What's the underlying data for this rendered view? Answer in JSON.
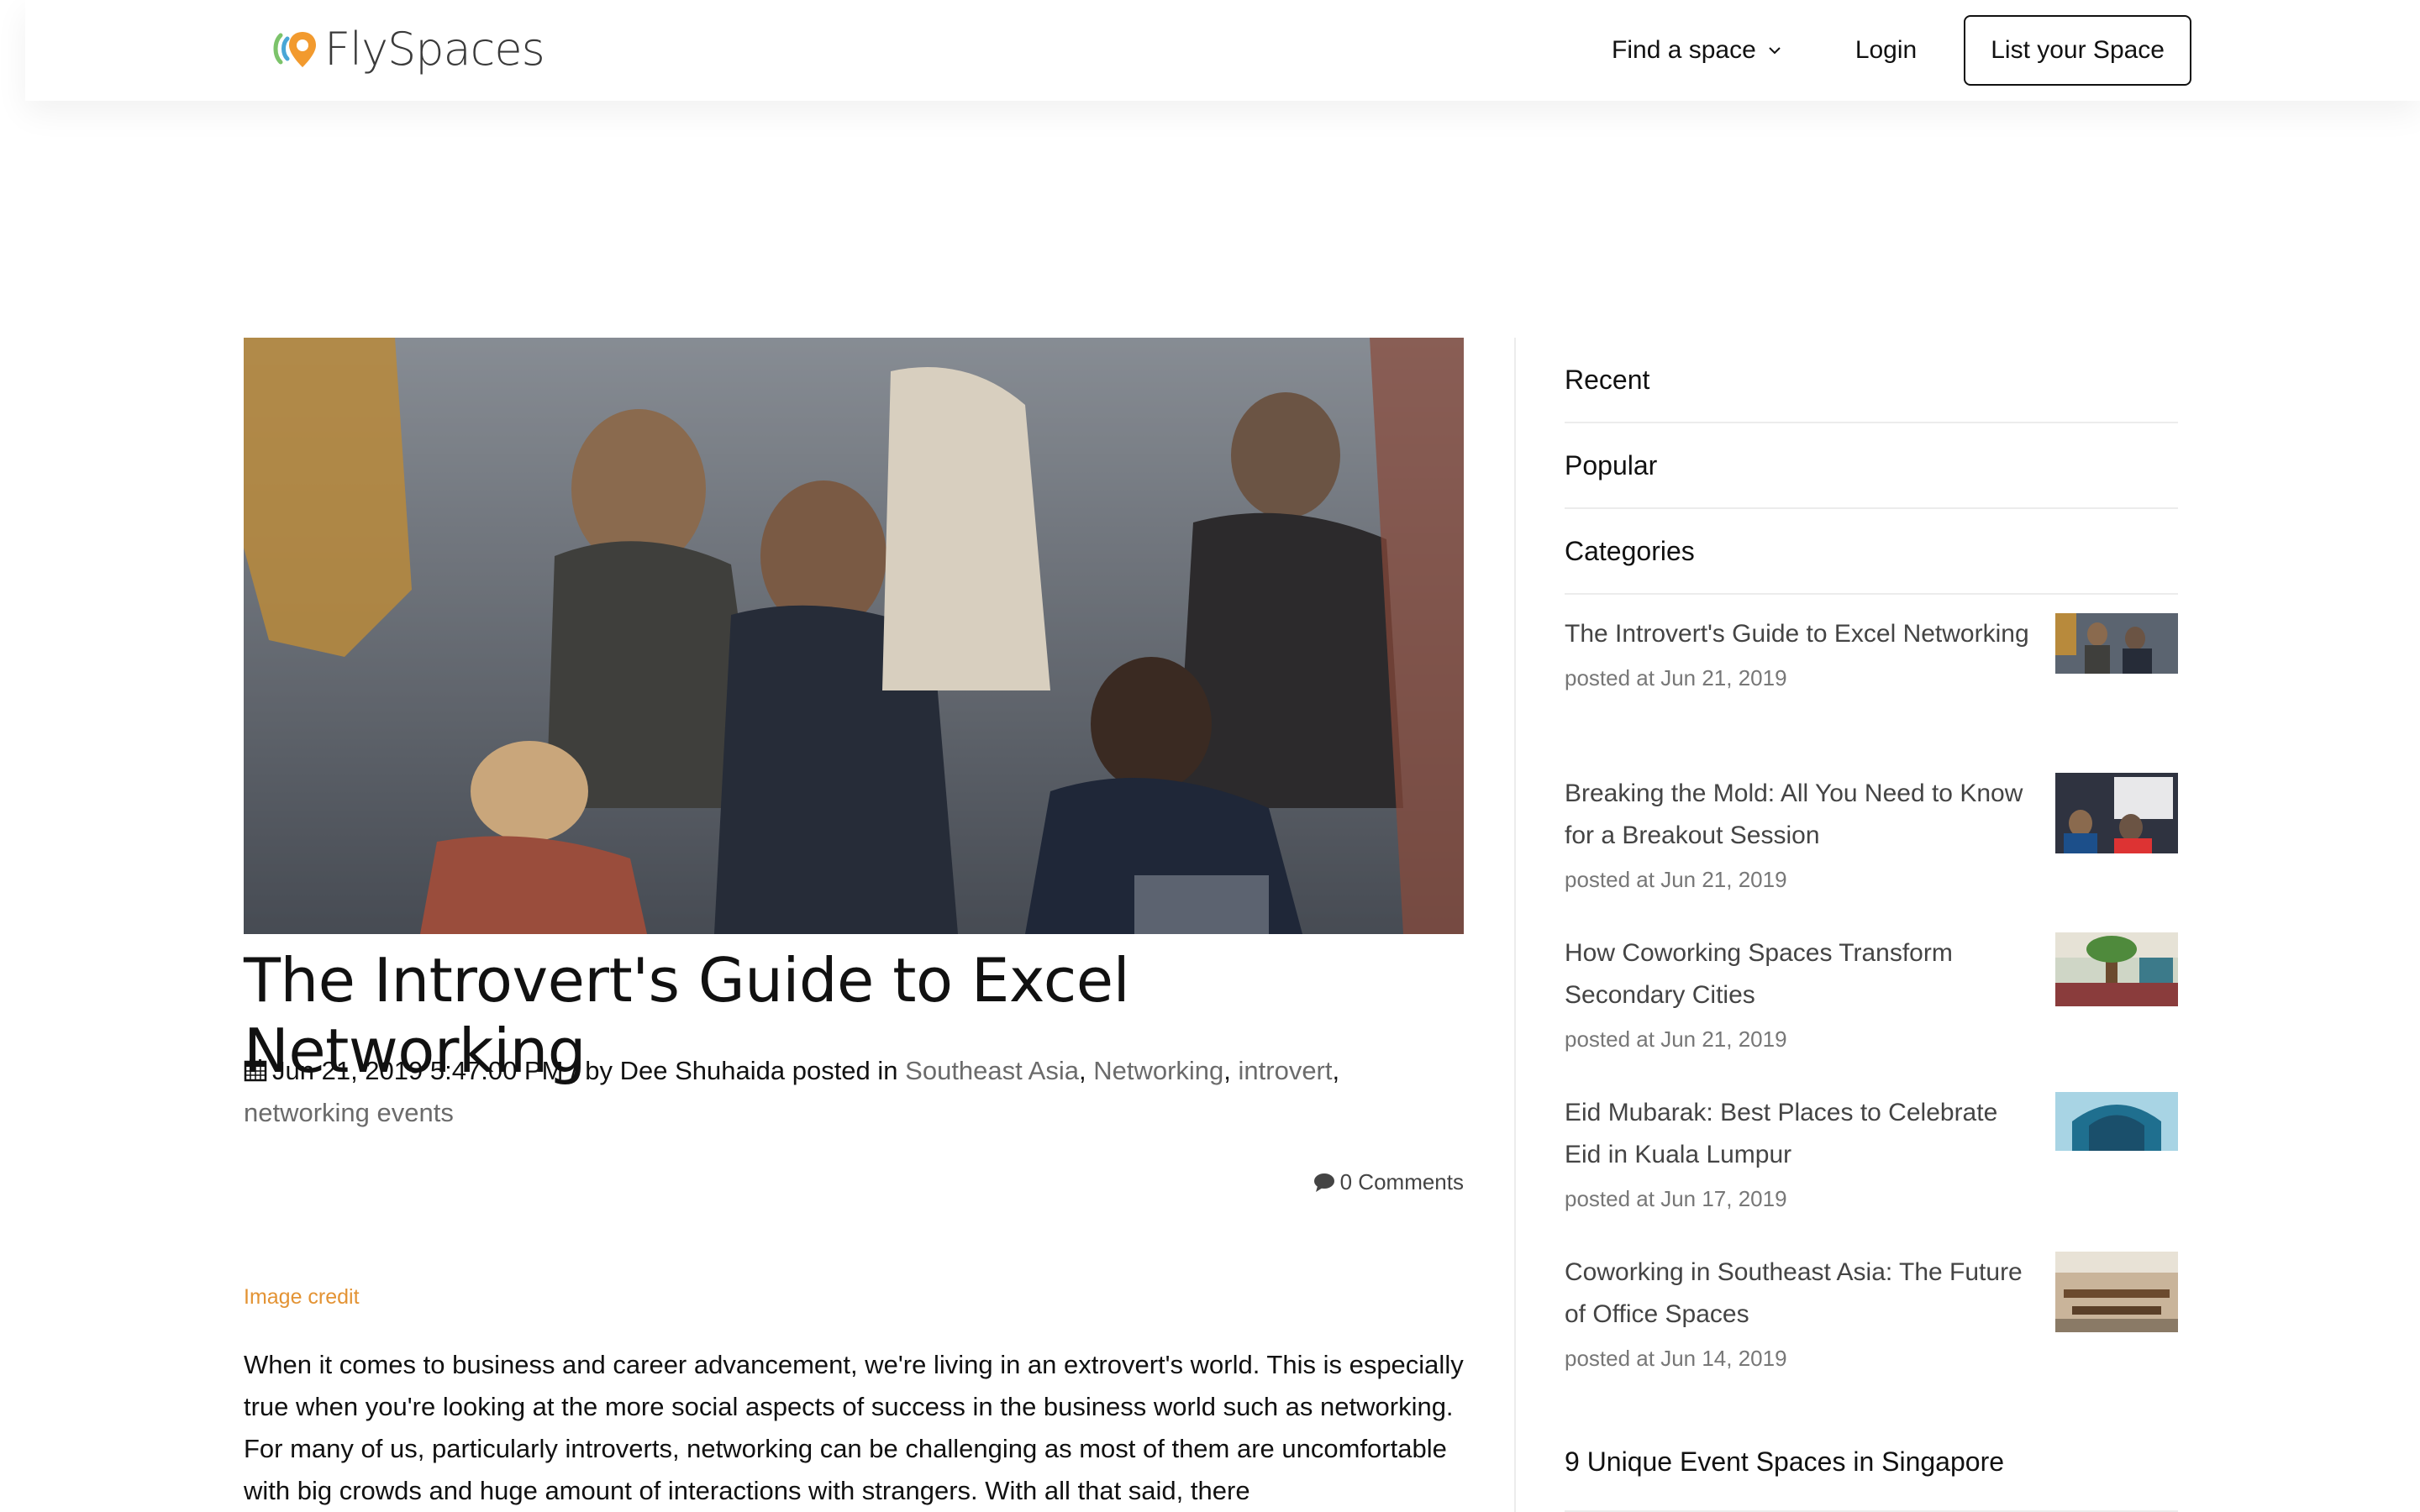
{
  "header": {
    "logo_text": "FlySpaces",
    "nav": {
      "find_label": "Find a space",
      "login_label": "Login",
      "list_label": "List your Space"
    }
  },
  "article": {
    "title": "The Introvert's Guide to Excel Networking",
    "meta": {
      "date": "Jun 21, 2019 5:47:00 PM / by Dee Shuhaida posted in",
      "tags": [
        "Southeast Asia",
        "Networking",
        "introvert",
        "networking events"
      ]
    },
    "comments_label": "0 Comments",
    "image_credit": "Image credit",
    "body": "When it comes to business and career advancement, we're living in an extrovert's world. This is especially true when you're looking at the more social aspects of success in the business world such as networking. For many of us, particularly introverts, networking can be challenging as most of them are uncomfortable with big crowds and huge amount of interactions with strangers. With all that said, there"
  },
  "sidebar": {
    "tabs": [
      "Recent",
      "Popular",
      "Categories"
    ],
    "posts": [
      {
        "title": "The Introvert's Guide to Excel Networking",
        "date": "posted at Jun 21, 2019"
      },
      {
        "title": "Breaking the Mold: All You Need to Know for a Breakout Session",
        "date": "posted at Jun 21, 2019"
      },
      {
        "title": "How Coworking Spaces Transform Secondary Cities",
        "date": "posted at Jun 21, 2019"
      },
      {
        "title": "Eid Mubarak: Best Places to Celebrate Eid in Kuala Lumpur",
        "date": "posted at Jun 17, 2019"
      },
      {
        "title": "Coworking in Southeast Asia: The Future of Office Spaces",
        "date": "posted at Jun 14, 2019"
      }
    ],
    "bottom_title": "9 Unique Event Spaces in Singapore"
  },
  "colors": {
    "accent": "#e39334",
    "tag_text": "#6b6b6b",
    "divider": "#ececec"
  }
}
